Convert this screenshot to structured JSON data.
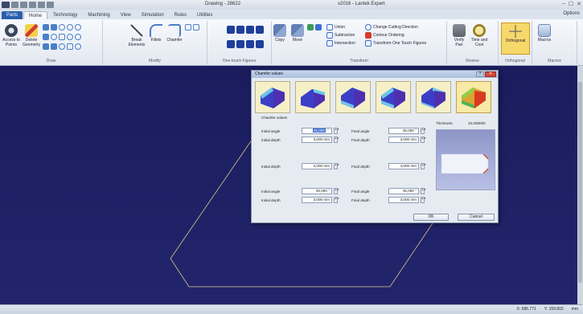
{
  "window": {
    "document_title": "Drawing - 28622",
    "app_title": "v2016 - Lantek Expert",
    "buttons": [
      "–",
      "☐",
      "✕"
    ]
  },
  "tabs": [
    {
      "label": "Parts",
      "style": "file"
    },
    {
      "label": "Home",
      "style": "active"
    },
    {
      "label": "Technology",
      "style": ""
    },
    {
      "label": "Machining",
      "style": ""
    },
    {
      "label": "View",
      "style": ""
    },
    {
      "label": "Simulation",
      "style": ""
    },
    {
      "label": "Rules",
      "style": ""
    },
    {
      "label": "Utilities",
      "style": ""
    }
  ],
  "tabs_right": "Options",
  "ribbon": {
    "groups": {
      "draw": "Draw",
      "modify": "Modify",
      "one_touch": "One-touch Figures",
      "transform": "Transform",
      "review": "Review",
      "orthogonal_group": "Orthogonal",
      "macros_group": "Macros"
    },
    "buttons": {
      "access_to_points": "Access to Points",
      "delete_geometry": "Delete Geometry",
      "break_elements": "Break Elements",
      "fillets": "Fillets",
      "chamfer": "Chamfer",
      "copy": "Copy",
      "move": "Move",
      "union": "Union",
      "subtraction": "Subtraction",
      "intersection": "Intersection",
      "change_cutting_direction": "Change Cutting Direction",
      "contour_ordering": "Contour Ordering",
      "transform_one_touch": "Transform One Touch Figures",
      "verify_part": "Verify Part",
      "time_and_cost": "Time and Cost",
      "orthogonal": "Orthogonal",
      "macros": "Macros"
    }
  },
  "status": {
    "x": "X: 586.771",
    "y": "Y: 159.802",
    "unit": "mm"
  },
  "dialog": {
    "title": "Chamfer values",
    "section_label": "Chamfer values",
    "thickness_label": "Thickness",
    "thickness_value": "10.000000",
    "row1": {
      "initial_angle_label": "Initial angle",
      "initial_angle_value": "45,000",
      "initial_angle_unit": "°",
      "final_angle_label": "Final angle",
      "final_angle_value": "45,000",
      "final_angle_unit": "°",
      "initial_depth_label": "Initial depth",
      "initial_depth_value": "3,000",
      "initial_depth_unit": "mm",
      "final_depth_label": "Final depth",
      "final_depth_value": "3,000",
      "final_depth_unit": "mm"
    },
    "row2": {
      "initial_depth_label": "Initial depth",
      "initial_depth_value": "4,000",
      "initial_depth_unit": "mm",
      "final_depth_label": "Final depth",
      "final_depth_value": "4,000",
      "final_depth_unit": "mm"
    },
    "row3": {
      "initial_angle_label": "Initial angle",
      "initial_angle_value": "45,000",
      "initial_angle_unit": "°",
      "final_angle_label": "Final angle",
      "final_angle_value": "45,000",
      "final_angle_unit": "°",
      "initial_depth_label": "Initial depth",
      "initial_depth_value": "3,000",
      "initial_depth_unit": "mm",
      "final_depth_label": "Final depth",
      "final_depth_value": "3,000",
      "final_depth_unit": "mm"
    },
    "ok_label": "OK",
    "cancel_label": "Cancel"
  },
  "colors": {
    "canvas": "#1e1f63",
    "accent": "#2b5fad",
    "contour": "#d8c98a"
  }
}
